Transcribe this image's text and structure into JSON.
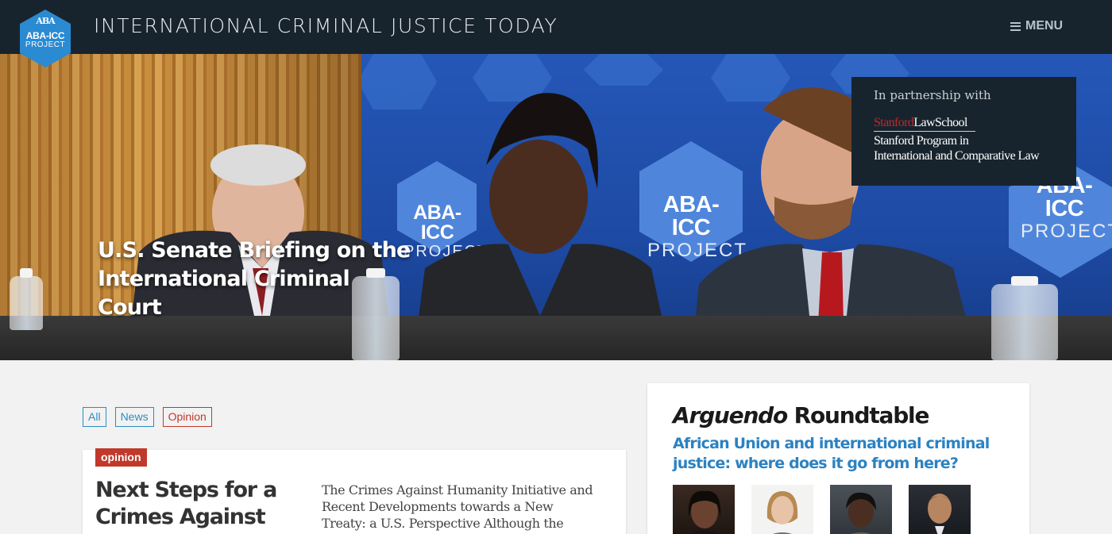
{
  "header": {
    "logo": {
      "line1": "ABA",
      "line2": "ABA-ICC",
      "line3": "PROJECT"
    },
    "site_title": "INTERNATIONAL CRIMINAL JUSTICE TODAY",
    "menu_label": "MENU",
    "menu_icon": "hamburger-icon"
  },
  "hero": {
    "caption_line1": "U.S. Senate Briefing on the",
    "caption_line2": "International Criminal Court",
    "backdrop_labels": [
      {
        "top": "ABA-ICC",
        "bottom": "PROJECT"
      },
      {
        "top": "ABA-ICC",
        "bottom": "PROJECT"
      },
      {
        "top": "ABA-ICC",
        "bottom": "PROJECT"
      }
    ],
    "partner": {
      "label": "In partnership with",
      "school_part1": "Stanford",
      "school_part2": "LawSchool",
      "program_line1": "Stanford Program in",
      "program_line2": "International and Comparative Law"
    }
  },
  "filters": {
    "all": "All",
    "news": "News",
    "opinion": "Opinion"
  },
  "article": {
    "tag": "opinion",
    "title_line1": "Next Steps for a",
    "title_line2": "Crimes Against",
    "excerpt": "The Crimes Against Humanity Initiative and Recent Developments towards a New Treaty: a U.S. Perspective Although the international"
  },
  "roundtable": {
    "title_italic": "Arguendo",
    "title_rest": " Roundtable",
    "link": "African Union and international criminal justice: where does it go from here?"
  },
  "colors": {
    "header_bg": "#18242d",
    "accent_blue": "#2b82c2",
    "opinion_red": "#c0392b",
    "logo_blue": "#2a8ad2"
  }
}
